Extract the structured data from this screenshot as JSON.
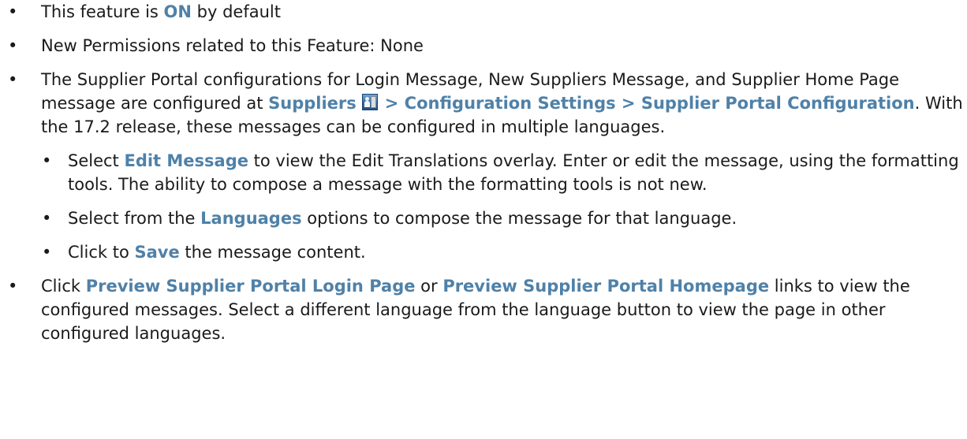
{
  "bullets": {
    "b1": {
      "pre": "This feature is ",
      "bold": "ON",
      "post": " by default"
    },
    "b2": {
      "text": "New Permissions related to this Feature: None"
    },
    "b3": {
      "pre": "The Supplier Portal configurations for Login Message, New Suppliers Message, and Supplier Home Page message are configured at ",
      "nav1": "Suppliers",
      "nav_icon": "supplier-icon",
      "nav2": " > Configuration Settings > Supplier Portal Configuration",
      "post": ". With the 17.2 release, these messages can be configured in multiple languages.",
      "sub": {
        "s1": {
          "pre": "Select ",
          "bold": "Edit Message",
          "post": " to view the Edit Translations overlay. Enter or edit the message, using the formatting tools. The ability to compose a message with the formatting tools is not new."
        },
        "s2": {
          "pre": "Select from the ",
          "bold": "Languages",
          "post": " options to compose the message for that language."
        },
        "s3": {
          "pre": "Click to ",
          "bold": "Save",
          "post": " the message content."
        }
      }
    },
    "b4": {
      "pre": "Click ",
      "bold1": "Preview Supplier Portal Login Page",
      "mid": " or ",
      "bold2": "Preview Supplier Portal Homepage",
      "post": " links to view the configured messages. Select a different language from the language button to view the page in other configured languages."
    }
  },
  "colors": {
    "emphasis": "#4f81a8",
    "text": "#1a1a1a"
  }
}
